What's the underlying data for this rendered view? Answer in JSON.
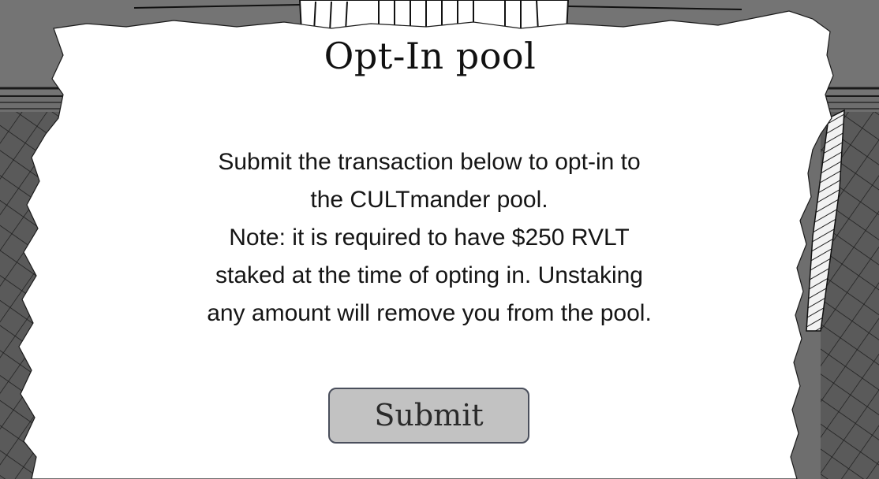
{
  "dialog": {
    "title": "Opt-In pool",
    "message_lines": [
      "Submit the transaction below to opt-in to",
      "the CULTmander pool.",
      "Note: it is required to have $250 RVLT",
      "staked at the time of opting in. Unstaking",
      "any amount will remove you from the pool."
    ],
    "submit_label": "Submit"
  },
  "colors": {
    "paper": "#ffffff",
    "backdrop": "#6b6b6b",
    "button_fill": "#c2c2c2",
    "button_border": "#4a4f5c"
  }
}
